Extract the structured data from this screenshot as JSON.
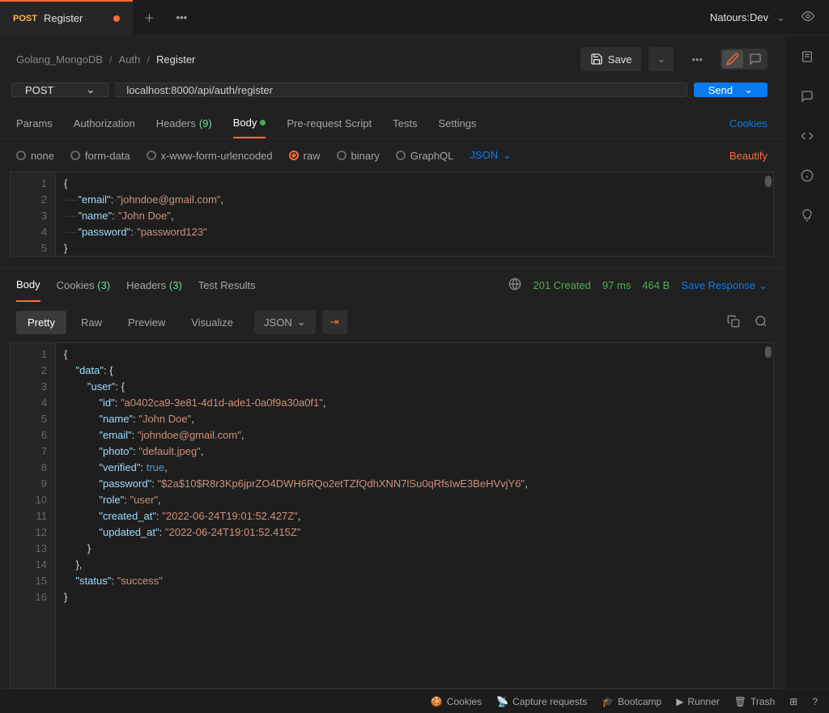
{
  "tab": {
    "method": "POST",
    "title": "Register",
    "dirty": true
  },
  "environment": "Natours:Dev",
  "breadcrumbs": [
    "Golang_MongoDB",
    "Auth",
    "Register"
  ],
  "save_label": "Save",
  "request": {
    "method": "POST",
    "url": "localhost:8000/api/auth/register"
  },
  "send_label": "Send",
  "req_tabs": {
    "params": "Params",
    "authorization": "Authorization",
    "headers": "Headers",
    "headers_count": "(9)",
    "body": "Body",
    "prerequest": "Pre-request Script",
    "tests": "Tests",
    "settings": "Settings",
    "cookies": "Cookies"
  },
  "body_types": {
    "none": "none",
    "formdata": "form-data",
    "urlencoded": "x-www-form-urlencoded",
    "raw": "raw",
    "binary": "binary",
    "graphql": "GraphQL",
    "json": "JSON",
    "beautify": "Beautify"
  },
  "request_body": {
    "lines": [
      "1",
      "2",
      "3",
      "4",
      "5"
    ],
    "email_k": "\"email\"",
    "email_v": "\"johndoe@gmail.com\"",
    "name_k": "\"name\"",
    "name_v": "\"John Doe\"",
    "password_k": "\"password\"",
    "password_v": "\"password123\""
  },
  "response_tabs": {
    "body": "Body",
    "cookies": "Cookies",
    "cookies_count": "(3)",
    "headers": "Headers",
    "headers_count": "(3)",
    "test_results": "Test Results"
  },
  "response_meta": {
    "status": "201 Created",
    "time": "97 ms",
    "size": "464 B",
    "save": "Save Response"
  },
  "view_modes": {
    "pretty": "Pretty",
    "raw": "Raw",
    "preview": "Preview",
    "visualize": "Visualize",
    "json": "JSON"
  },
  "response_body": {
    "lines": [
      "1",
      "2",
      "3",
      "4",
      "5",
      "6",
      "7",
      "8",
      "9",
      "10",
      "11",
      "12",
      "13",
      "14",
      "15",
      "16"
    ],
    "data_k": "\"data\"",
    "user_k": "\"user\"",
    "id_k": "\"id\"",
    "id_v": "\"a0402ca9-3e81-4d1d-ade1-0a0f9a30a0f1\"",
    "name_k": "\"name\"",
    "name_v": "\"John Doe\"",
    "email_k": "\"email\"",
    "email_v": "\"johndoe@gmail.com\"",
    "photo_k": "\"photo\"",
    "photo_v": "\"default.jpeg\"",
    "verified_k": "\"verified\"",
    "verified_v": "true",
    "password_k": "\"password\"",
    "password_v": "\"$2a$10$R8r3Kp6jprZO4DWH6RQo2etTZfQdhXNN7lSu0qRfsIwE3BeHVvjY6\"",
    "role_k": "\"role\"",
    "role_v": "\"user\"",
    "created_k": "\"created_at\"",
    "created_v": "\"2022-06-24T19:01:52.427Z\"",
    "updated_k": "\"updated_at\"",
    "updated_v": "\"2022-06-24T19:01:52.415Z\"",
    "status_k": "\"status\"",
    "status_v": "\"success\""
  },
  "footer": {
    "cookies": "Cookies",
    "capture": "Capture requests",
    "bootcamp": "Bootcamp",
    "runner": "Runner",
    "trash": "Trash"
  }
}
